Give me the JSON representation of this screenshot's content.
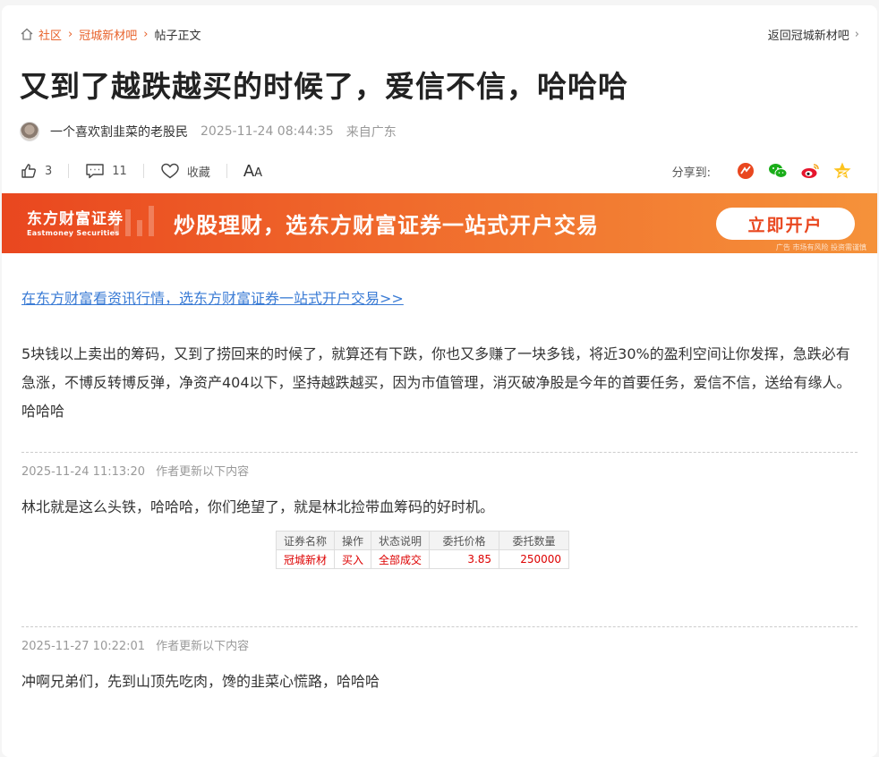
{
  "breadcrumb": {
    "items": [
      "社区",
      "冠城新材吧"
    ],
    "current": "帖子正文",
    "back_label": "返回冠城新材吧"
  },
  "post": {
    "title": "又到了越跌越买的时候了，爱信不信，哈哈哈",
    "author": "一个喜欢割韭菜的老股民",
    "time": "2025-11-24 08:44:35",
    "from": "来自广东"
  },
  "actions": {
    "likes": "3",
    "comments": "11",
    "favorite_label": "收藏",
    "font_label_big": "A",
    "font_label_small": "A",
    "share_label": "分享到:"
  },
  "banner": {
    "logo_cn": "东方财富证券",
    "logo_en": "Eastmoney Securities",
    "slogan": "炒股理财，选东方财富证券一站式开户交易",
    "cta": "立即开户",
    "risk": "广告 市场有风险 投资需谨慎"
  },
  "promo_link": "在东方财富看资讯行情，选东方财富证券一站式开户交易>>",
  "content": "5块钱以上卖出的筹码，又到了捞回来的时候了，就算还有下跌，你也又多赚了一块多钱，将近30%的盈利空间让你发挥，急跌必有急涨，不博反转博反弹，净资产404以下，坚持越跌越买，因为市值管理，消灭破净股是今年的首要任务，爱信不信，送给有缘人。哈哈哈",
  "updates": [
    {
      "time": "2025-11-24 11:13:20",
      "label": "作者更新以下内容",
      "text": "林北就是这么头铁，哈哈哈，你们绝望了，就是林北捡带血筹码的好时机。"
    },
    {
      "time": "2025-11-27 10:22:01",
      "label": "作者更新以下内容",
      "text": "冲啊兄弟们，先到山顶先吃肉，馋的韭菜心慌路，哈哈哈"
    }
  ],
  "trade_table": {
    "headers": [
      "证券名称",
      "操作",
      "状态说明",
      "委托价格",
      "委托数量"
    ],
    "row": [
      "冠城新材",
      "买入",
      "全部成交",
      "3.85",
      "250000"
    ]
  },
  "colors": {
    "accent": "#e8622a",
    "link": "#3a7bd5",
    "banner_start": "#e9471f",
    "banner_end": "#f5923a",
    "trade_text": "#dd0000"
  },
  "icons": [
    "home-icon",
    "chevron-right-icon",
    "thumbs-up-icon",
    "comment-icon",
    "heart-icon",
    "font-size-icon",
    "share-app-icon",
    "wechat-icon",
    "weibo-icon",
    "qzone-icon"
  ]
}
